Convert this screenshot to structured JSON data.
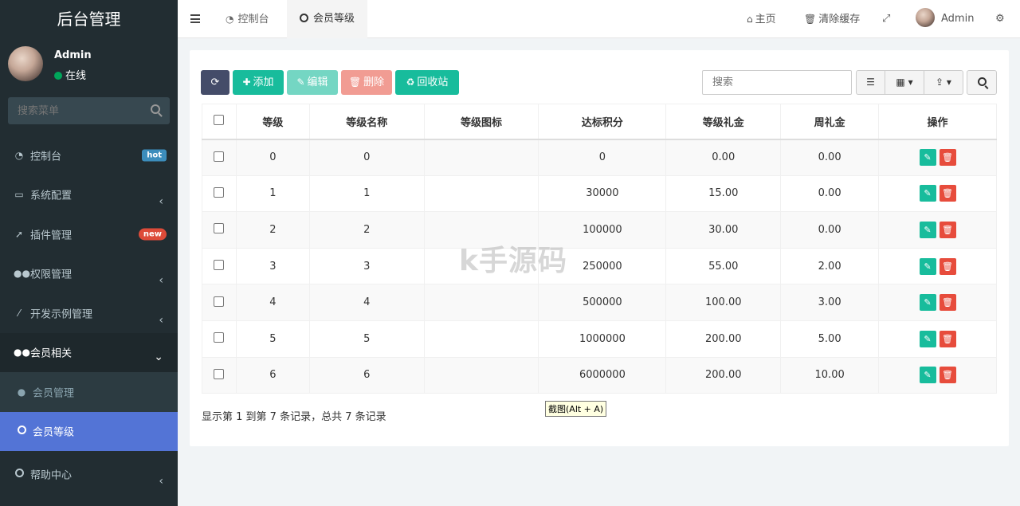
{
  "brand": "后台管理",
  "user": {
    "name": "Admin",
    "status": "在线"
  },
  "sidebar": {
    "search_placeholder": "搜索菜单",
    "items": [
      {
        "label": "控制台",
        "icon": "dashboard-icon",
        "badge": "hot"
      },
      {
        "label": "系统配置",
        "icon": "desktop-icon"
      },
      {
        "label": "插件管理",
        "icon": "rocket-icon",
        "badge": "new"
      },
      {
        "label": "权限管理",
        "icon": "users-icon"
      },
      {
        "label": "开发示例管理",
        "icon": "magic-icon"
      },
      {
        "label": "会员相关",
        "icon": "users-icon"
      },
      {
        "label": "会员管理",
        "icon": "user-icon"
      },
      {
        "label": "会员等级",
        "icon": "circle-icon"
      },
      {
        "label": "帮助中心",
        "icon": "circle-icon"
      }
    ]
  },
  "topbar": {
    "tabs": [
      "控制台",
      "会员等级"
    ],
    "home": "主页",
    "clear_cache": "清除缓存",
    "user": "Admin"
  },
  "toolbar": {
    "add": "添加",
    "edit": "编辑",
    "delete": "删除",
    "recycle": "回收站",
    "search_placeholder": "搜索"
  },
  "table": {
    "columns": [
      "等级",
      "等级名称",
      "等级图标",
      "达标积分",
      "等级礼金",
      "周礼金",
      "操作"
    ],
    "rows": [
      [
        "0",
        "0",
        "",
        "0",
        "0.00",
        "0.00"
      ],
      [
        "1",
        "1",
        "",
        "30000",
        "15.00",
        "0.00"
      ],
      [
        "2",
        "2",
        "",
        "100000",
        "30.00",
        "0.00"
      ],
      [
        "3",
        "3",
        "",
        "250000",
        "55.00",
        "2.00"
      ],
      [
        "4",
        "4",
        "",
        "500000",
        "100.00",
        "3.00"
      ],
      [
        "5",
        "5",
        "",
        "1000000",
        "200.00",
        "5.00"
      ],
      [
        "6",
        "6",
        "",
        "6000000",
        "200.00",
        "10.00"
      ]
    ]
  },
  "pagination_info": "显示第 1 到第 7 条记录，总共 7 条记录",
  "tooltip": "截图(Alt + A)",
  "watermark": "k手源码",
  "colors": {
    "sidebar": "#222d32",
    "active": "#5374d6",
    "success": "#18bc9c",
    "danger": "#e74c3c"
  }
}
